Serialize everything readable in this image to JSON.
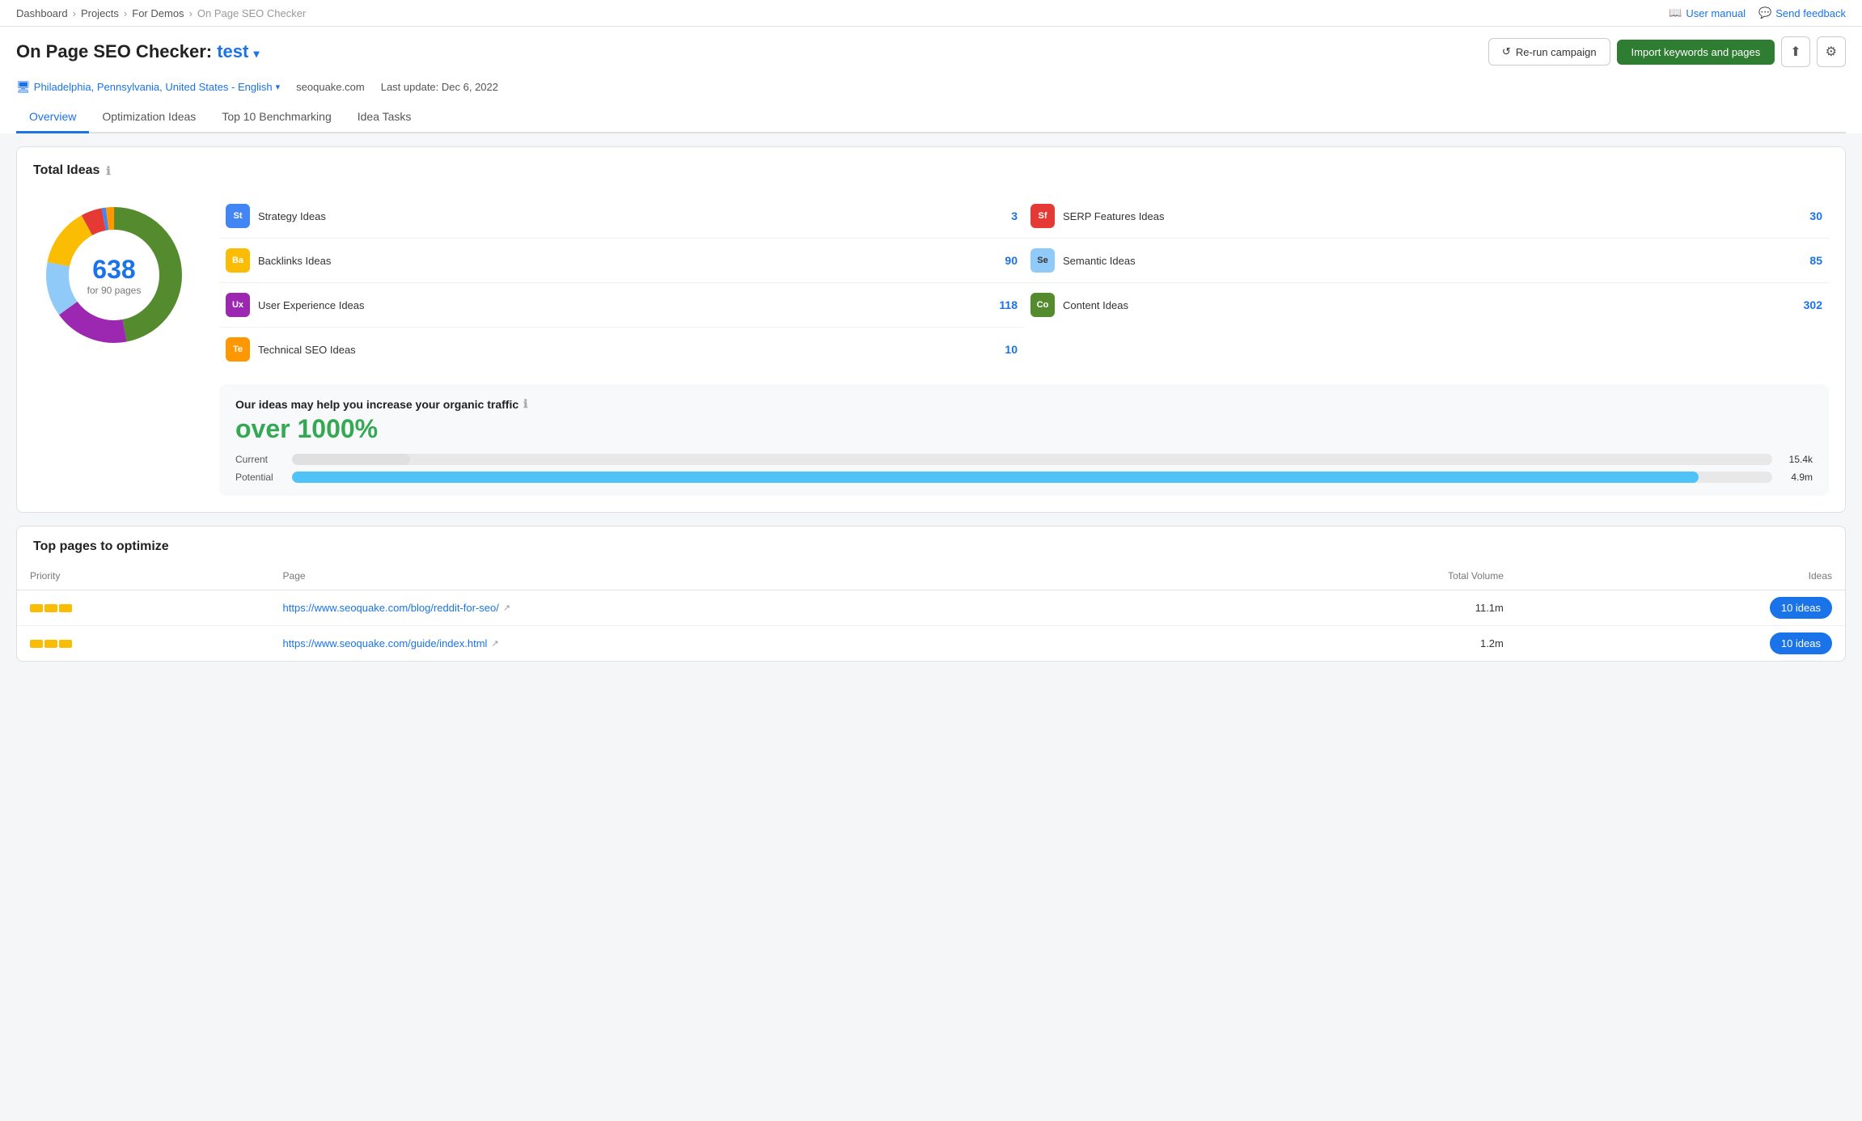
{
  "breadcrumb": {
    "items": [
      "Dashboard",
      "Projects",
      "For Demos",
      "On Page SEO Checker"
    ]
  },
  "top_actions": {
    "user_manual": "User manual",
    "send_feedback": "Send feedback"
  },
  "page": {
    "title_prefix": "On Page SEO Checker:",
    "project_name": "test",
    "location": "Philadelphia, Pennsylvania, United States - English",
    "domain": "seoquake.com",
    "last_update": "Last update: Dec 6, 2022",
    "btn_rerun": "Re-run campaign",
    "btn_import": "Import keywords and pages"
  },
  "tabs": [
    "Overview",
    "Optimization Ideas",
    "Top 10 Benchmarking",
    "Idea Tasks"
  ],
  "active_tab": 0,
  "total_ideas": {
    "title": "Total Ideas",
    "total": "638",
    "pages": "for 90 pages",
    "ideas": [
      {
        "key": "St",
        "badge_class": "badge-st",
        "label": "Strategy Ideas",
        "count": "3"
      },
      {
        "key": "Ba",
        "badge_class": "badge-ba",
        "label": "Backlinks Ideas",
        "count": "90"
      },
      {
        "key": "Ux",
        "badge_class": "badge-ux",
        "label": "User Experience Ideas",
        "count": "118"
      },
      {
        "key": "Te",
        "badge_class": "badge-te",
        "label": "Technical SEO Ideas",
        "count": "10"
      },
      {
        "key": "Sf",
        "badge_class": "badge-sf",
        "label": "SERP Features Ideas",
        "count": "30"
      },
      {
        "key": "Se",
        "badge_class": "badge-se",
        "label": "Semantic Ideas",
        "count": "85"
      },
      {
        "key": "Co",
        "badge_class": "badge-co",
        "label": "Content Ideas",
        "count": "302"
      }
    ]
  },
  "traffic": {
    "title": "Our ideas may help you increase your organic traffic",
    "percent": "over 1000%",
    "current_label": "Current",
    "current_value": "15.4k",
    "current_width": "8%",
    "potential_label": "Potential",
    "potential_value": "4.9m",
    "potential_width": "95%"
  },
  "top_pages": {
    "title": "Top pages to optimize",
    "columns": {
      "priority": "Priority",
      "page": "Page",
      "total_volume": "Total Volume",
      "ideas": "Ideas"
    },
    "rows": [
      {
        "priority_bars": 3,
        "url": "https://www.seoquake.com/blog/reddit-for-seo/",
        "volume": "11.1m",
        "ideas_count": "10 ideas"
      },
      {
        "priority_bars": 3,
        "url": "https://www.seoquake.com/guide/index.html",
        "volume": "1.2m",
        "ideas_count": "10 ideas"
      }
    ]
  },
  "donut": {
    "segments": [
      {
        "label": "Content Ideas",
        "color": "#558b2f",
        "percent": 47
      },
      {
        "label": "User Experience Ideas",
        "color": "#9c27b0",
        "percent": 18
      },
      {
        "label": "Semantic Ideas",
        "color": "#90caf9",
        "percent": 13
      },
      {
        "label": "Backlinks Ideas",
        "color": "#fbbc04",
        "percent": 14
      },
      {
        "label": "SERP Features Ideas",
        "color": "#e53935",
        "percent": 5
      },
      {
        "label": "Strategy Ideas",
        "color": "#4285f4",
        "percent": 1
      },
      {
        "label": "Technical SEO Ideas",
        "color": "#ff9800",
        "percent": 2
      }
    ]
  }
}
